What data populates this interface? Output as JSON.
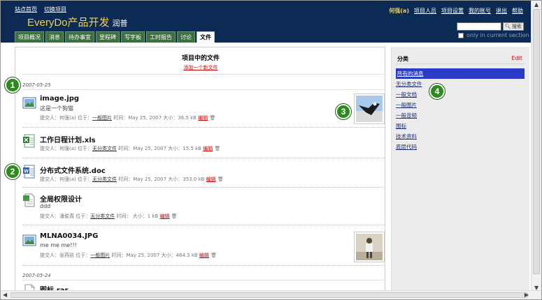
{
  "header": {
    "links": [
      "站点首页",
      "切换项目"
    ],
    "brand": "EveryDo产品开发",
    "brand_sub": "润普",
    "user": "何强(a)",
    "user_links": [
      "项目人员",
      "项目设置",
      "我的账号",
      "退出",
      "帮助"
    ],
    "search_button": "搜索",
    "only_in_section": "only in current section"
  },
  "tabs": [
    "项目概况",
    "消息",
    "待办事宜",
    "里程碑",
    "写字板",
    "工时报告",
    "讨论",
    "文件"
  ],
  "active_tab": "文件",
  "content": {
    "title": "项目中的文件",
    "add_link": "添加一个新文件",
    "dates": [
      "2007-05-25",
      "2007-05-24"
    ],
    "files": [
      {
        "name": "image.jpg",
        "desc": "这是一个狗猫",
        "meta_prefix": "提交人：何强(a) 位于：",
        "folder": "一般图片",
        "meta_suffix": "时间：May 25, 2007 大小：36.5 kB",
        "edit": "编辑",
        "icon": "image-file-icon",
        "thumb": "eagle"
      },
      {
        "name": "工作日程计划.xls",
        "desc": "",
        "meta_prefix": "提交人：何强(a) 位于：",
        "folder": "无分类文件",
        "meta_suffix": "时间：May 25, 2007 大小：15.5 kB",
        "edit": "编辑",
        "icon": "excel-file-icon",
        "thumb": ""
      },
      {
        "name": "分布式文件系统.doc",
        "desc": "",
        "meta_prefix": "提交人：何强(a) 位于：",
        "folder": "无分类文件",
        "meta_suffix": "时间：May 25, 2007 大小：353.0 kB",
        "edit": "编辑",
        "icon": "word-file-icon",
        "thumb": ""
      },
      {
        "name": "全局权限设计",
        "desc": "ddd",
        "meta_prefix": "提交人：潘俊真 位于：",
        "folder": "无分类文件",
        "meta_suffix": "时间：  大小：1 kB",
        "edit": "编辑",
        "icon": "text-file-icon",
        "thumb": ""
      },
      {
        "name": "MLNA0034.JPG",
        "desc": "me me me!!!",
        "meta_prefix": "提交人：张燕凯 位于：",
        "folder": "一般图片",
        "meta_suffix": "时间：May 25, 2007 大小：464.3 kB",
        "edit": "编辑",
        "icon": "image-file-icon",
        "thumb": "person"
      },
      {
        "name": "图标.rar",
        "desc": "",
        "meta_prefix": "",
        "folder": "",
        "meta_suffix": "",
        "edit": "",
        "icon": "archive-file-icon",
        "thumb": ""
      }
    ]
  },
  "sidebar": {
    "heading": "分类",
    "edit": "Edit",
    "items": [
      "所有的消息",
      "无分类文件",
      "一般文档",
      "一般图片",
      "一般音频",
      "图标",
      "技术资料",
      "底层代码"
    ],
    "selected": "所有的消息"
  },
  "markers": [
    "1",
    "2",
    "3",
    "4"
  ],
  "colors": {
    "header_bg": "#0b2a54",
    "brand": "#f3cf52",
    "tab_bg": "#3f6f3f",
    "marker": "#2d8a1e",
    "link_red": "#cc0000",
    "selected": "#2b3cc4"
  }
}
